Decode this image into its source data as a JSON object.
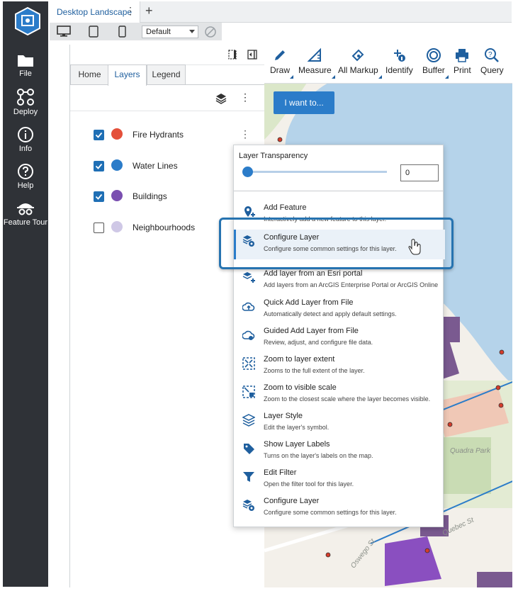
{
  "app": {
    "nav": [
      {
        "label": "File",
        "icon": "folder-icon"
      },
      {
        "label": "Deploy",
        "icon": "deploy-icon"
      },
      {
        "label": "Info",
        "icon": "info-icon"
      },
      {
        "label": "Help",
        "icon": "help-icon"
      },
      {
        "label": "Feature Tour",
        "icon": "feature-tour-icon"
      }
    ]
  },
  "tabs": {
    "active_tab": "Desktop Landscape",
    "add_icon": "plus-icon",
    "device_preset": "Default"
  },
  "panel": {
    "tabs": [
      "Home",
      "Layers",
      "Legend"
    ],
    "active_tab": "Layers",
    "layers": [
      {
        "name": "Fire Hydrants",
        "checked": true,
        "icon_color": "#e4503a"
      },
      {
        "name": "Water Lines",
        "checked": true,
        "icon_color": "#2b7cc9"
      },
      {
        "name": "Buildings",
        "checked": true,
        "icon_color": "#7a4fb0"
      },
      {
        "name": "Neighbourhoods",
        "checked": false,
        "icon_color": "#cfc8e6"
      }
    ]
  },
  "map": {
    "tools": [
      {
        "label": "Draw",
        "icon": "pencil-icon"
      },
      {
        "label": "Measure",
        "icon": "ruler-icon"
      },
      {
        "label": "All Markup",
        "icon": "markup-icon"
      },
      {
        "label": "Identify",
        "icon": "identify-icon"
      },
      {
        "label": "Buffer",
        "icon": "buffer-icon"
      },
      {
        "label": "Print",
        "icon": "printer-icon"
      },
      {
        "label": "Query",
        "icon": "query-icon"
      }
    ],
    "i_want_to": "I want to...",
    "labels": {
      "park": "Quadra Park",
      "street1": "Oswego St",
      "street2": "Quebec St"
    }
  },
  "menu": {
    "transparency_title": "Layer Transparency",
    "transparency_value": "0",
    "transparency_level": 0,
    "items": [
      {
        "title": "Add Feature",
        "desc": "Interactively add a new feature to this layer.",
        "icon": "add-feature-icon"
      },
      {
        "title": "Configure Layer",
        "desc": "Configure some common settings for this layer.",
        "icon": "configure-layer-icon",
        "selected": true
      },
      {
        "title": "Add layer from an Esri portal",
        "desc": "Add layers from an ArcGIS Enterprise Portal or ArcGIS Online",
        "icon": "add-layer-icon"
      },
      {
        "title": "Quick Add Layer from File",
        "desc": "Automatically detect and apply default settings.",
        "icon": "cloud-upload-icon"
      },
      {
        "title": "Guided Add Layer from File",
        "desc": "Review, adjust, and configure file data.",
        "icon": "cloud-gear-icon"
      },
      {
        "title": "Zoom to layer extent",
        "desc": "Zooms to the full extent of the layer.",
        "icon": "zoom-extent-icon"
      },
      {
        "title": "Zoom to visible scale",
        "desc": "Zoom to the closest scale where the layer becomes visible.",
        "icon": "zoom-scale-icon"
      },
      {
        "title": "Layer Style",
        "desc": "Edit the layer's symbol.",
        "icon": "layer-style-icon"
      },
      {
        "title": "Show Layer Labels",
        "desc": "Turns on the layer's labels on the map.",
        "icon": "label-tag-icon"
      },
      {
        "title": "Edit Filter",
        "desc": "Open the filter tool for this layer.",
        "icon": "filter-icon"
      },
      {
        "title": "Configure Layer",
        "desc": "Configure some common settings for this layer.",
        "icon": "configure-layer-icon"
      }
    ]
  },
  "colors": {
    "sidebar": "#2f3237",
    "accent": "#2b7cc9",
    "highlight_border": "#2673b0"
  }
}
